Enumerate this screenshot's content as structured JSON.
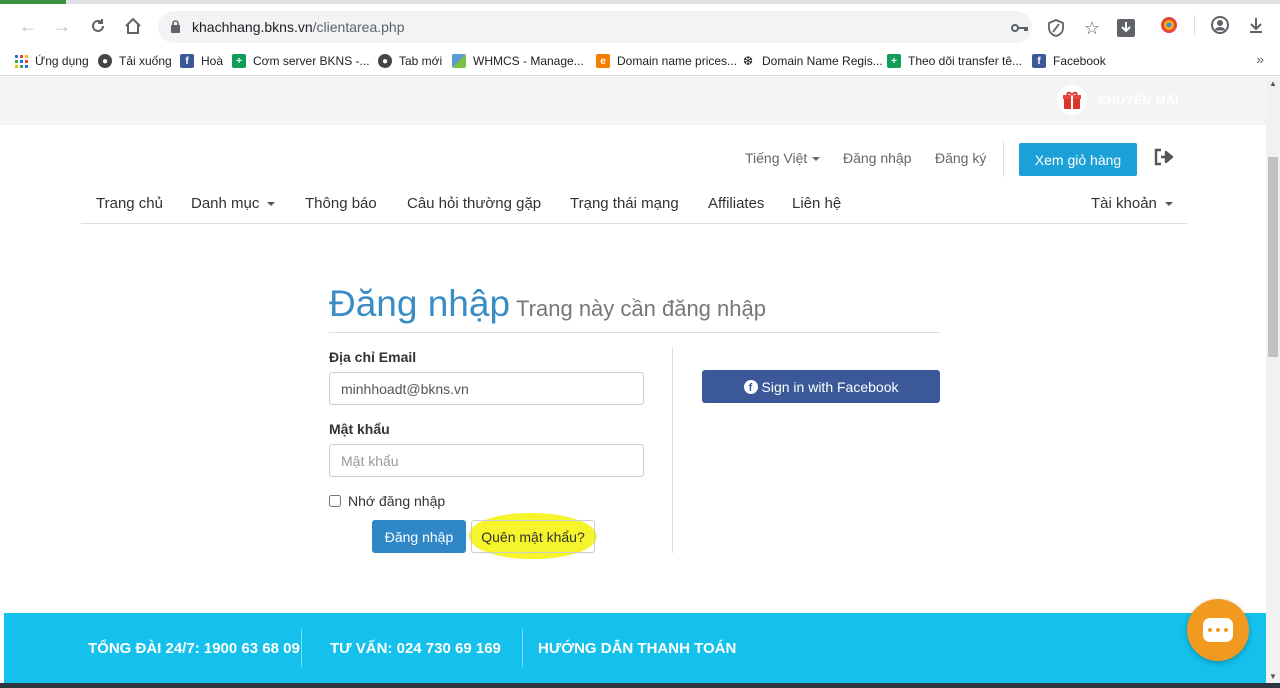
{
  "browser": {
    "url_host": "khachhang.bkns.vn",
    "url_path": "/clientarea.php",
    "bookmarks": [
      {
        "label": "Ứng dụng",
        "icon": "apps-grid-icon"
      },
      {
        "label": "Tải xuống",
        "icon": "globe-icon"
      },
      {
        "label": "Hoà",
        "icon": "facebook-icon"
      },
      {
        "label": "Cơm server BKNS -...",
        "icon": "green-plus-icon"
      },
      {
        "label": "Tab mới",
        "icon": "globe-icon"
      },
      {
        "label": "WHMCS - Manage...",
        "icon": "whmcs-icon"
      },
      {
        "label": "Domain name prices...",
        "icon": "orange-site-icon"
      },
      {
        "label": "Domain Name Regis...",
        "icon": "bird-icon"
      },
      {
        "label": "Theo dõi transfer tê...",
        "icon": "green-plus-icon"
      },
      {
        "label": "Facebook",
        "icon": "facebook-icon"
      }
    ],
    "more": "»"
  },
  "promo": {
    "label": "KHUYẾN MÃI"
  },
  "topnav": {
    "language": "Tiếng Việt",
    "login": "Đăng nhập",
    "register": "Đăng ký",
    "cart": "Xem giỏ hàng"
  },
  "mainnav": {
    "items": [
      {
        "label": "Trang chủ"
      },
      {
        "label": "Danh mục"
      },
      {
        "label": "Thông báo"
      },
      {
        "label": "Câu hỏi thường gặp"
      },
      {
        "label": "Trạng thái mạng"
      },
      {
        "label": "Affiliates"
      },
      {
        "label": "Liên hệ"
      }
    ],
    "account": "Tài khoản"
  },
  "login": {
    "title": "Đăng nhập",
    "subtitle": "Trang này cần đăng nhập",
    "email_label": "Địa chỉ Email",
    "email_value": "minhhoadt@bkns.vn",
    "password_label": "Mật khẩu",
    "password_placeholder": "Mật khẩu",
    "remember_label": "Nhớ đăng nhập",
    "submit": "Đăng nhập",
    "forgot": "Quên mật khẩu?",
    "facebook": "Sign in with Facebook"
  },
  "footer": {
    "hotline": "TỔNG ĐÀI 24/7: 1900 63 68 09",
    "consult": "TƯ VẤN: 024 730 69 169",
    "payment_guide": "HƯỚNG DẪN THANH TOÁN"
  },
  "colors": {
    "brand_blue": "#1ba0d8",
    "title_blue": "#3a8dc4",
    "footer_cyan": "#14c1ec",
    "facebook": "#3b5998",
    "highlight": "#f6f42b",
    "chat_orange": "#f29a1f"
  }
}
